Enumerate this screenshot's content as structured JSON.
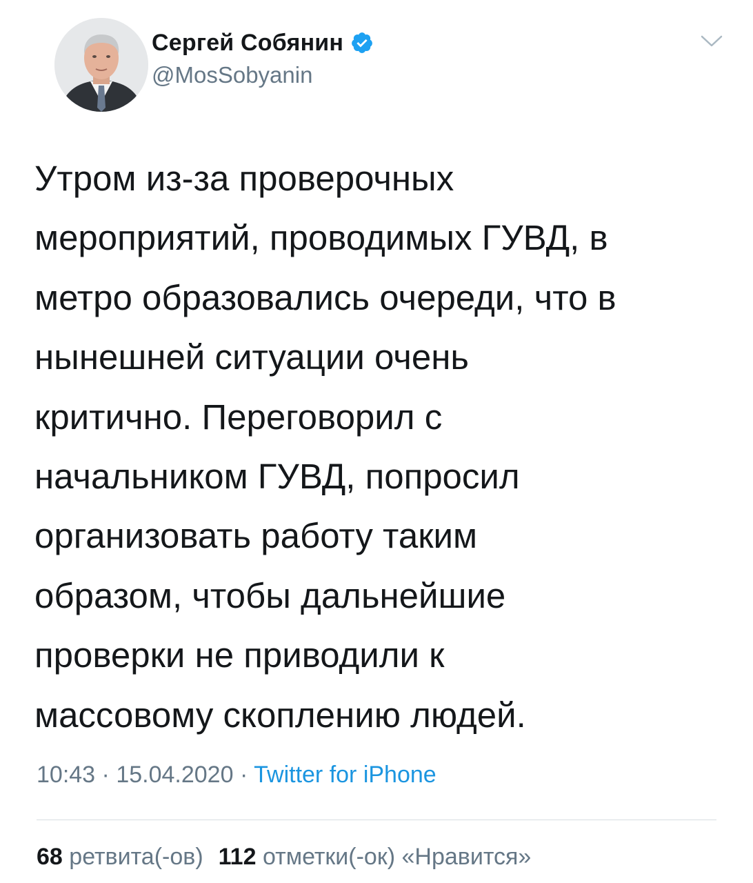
{
  "author": {
    "display_name": "Сергей Собянин",
    "handle": "@MosSobyanin",
    "verified": true
  },
  "tweet": {
    "text": "Утром из-за проверочных\nмероприятий, проводимых ГУВД, в\nметро образовались очереди, что в\nнынешней ситуации очень\nкритично. Переговорил с\nначальником ГУВД, попросил\nорганизовать работу таким\nобразом, чтобы дальнейшие\nпроверки не приводили к\nмассовому скоплению людей.",
    "time": "10:43",
    "date": "15.04.2020",
    "separator": "·",
    "source": "Twitter for iPhone"
  },
  "stats": {
    "retweets_count": "68",
    "retweets_label": "ретвита(-ов)",
    "likes_count": "112",
    "likes_label": "отметки(-ок) «Нравится»"
  },
  "icons": {
    "verified": "verified-badge-icon",
    "more": "chevron-down-icon"
  },
  "colors": {
    "accent": "#1da1f2",
    "link": "#1b95e0",
    "secondary_text": "#657786",
    "primary_text": "#14171a",
    "divider": "#d8dde1"
  }
}
